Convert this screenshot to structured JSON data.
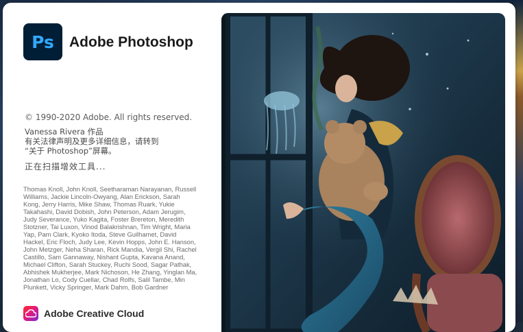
{
  "app": {
    "logo_text": "Ps",
    "name": "Adobe Photoshop"
  },
  "info": {
    "copyright": "© 1990-2020 Adobe. All rights reserved.",
    "artwork_lines": [
      "Vanessa Rivera 作品",
      "有关法律声明及更多详细信息，请转到",
      "“关于 Photoshop”屏幕。"
    ],
    "loading": "正在扫描增效工具..."
  },
  "credits": "Thomas Knoll, John Knoll, Seetharaman Narayanan, Russell Williams, Jackie Lincoln-Owyang, Alan Erickson, Sarah Kong, Jerry Harris, Mike Shaw, Thomas Ruark, Yukie Takahashi, David Dobish, John Peterson, Adam Jerugim, Judy Severance, Yuko Kagita, Foster Brereton, Meredith Stotzner, Tai Luxon, Vinod Balakrishnan, Tim Wright, Maria Yap, Pam Clark, Kyoko Itoda, Steve Guilhamet, David Hackel, Eric Floch, Judy Lee, Kevin Hopps, John E. Hanson, John Metzger, Neha Sharan, Rick Mandia, Vergil Shi, Rachel Castillo, Sam Gannaway, Nishant Gupta, Kavana Anand, Michael Clifton, Sarah Stuckey, Ruchi Sood, Sagar Pathak, Abhishek Mukherjee, Mark Nichoson, He Zhang, Yinglan Ma, Jonathan Lo, Cody Cuellar, Chad Rolfs, Salil Tambe, Min Plunkett, Vicky Springer, Mark Dahm, Bob Gardner",
  "footer": {
    "cc_label": "Adobe Creative Cloud"
  },
  "colors": {
    "ps_bg": "#001e36",
    "ps_fg": "#31a8ff",
    "splash_bg": "#ffffff"
  },
  "icons": {
    "app_logo": "photoshop-logo-icon",
    "cc_logo": "creative-cloud-icon"
  }
}
